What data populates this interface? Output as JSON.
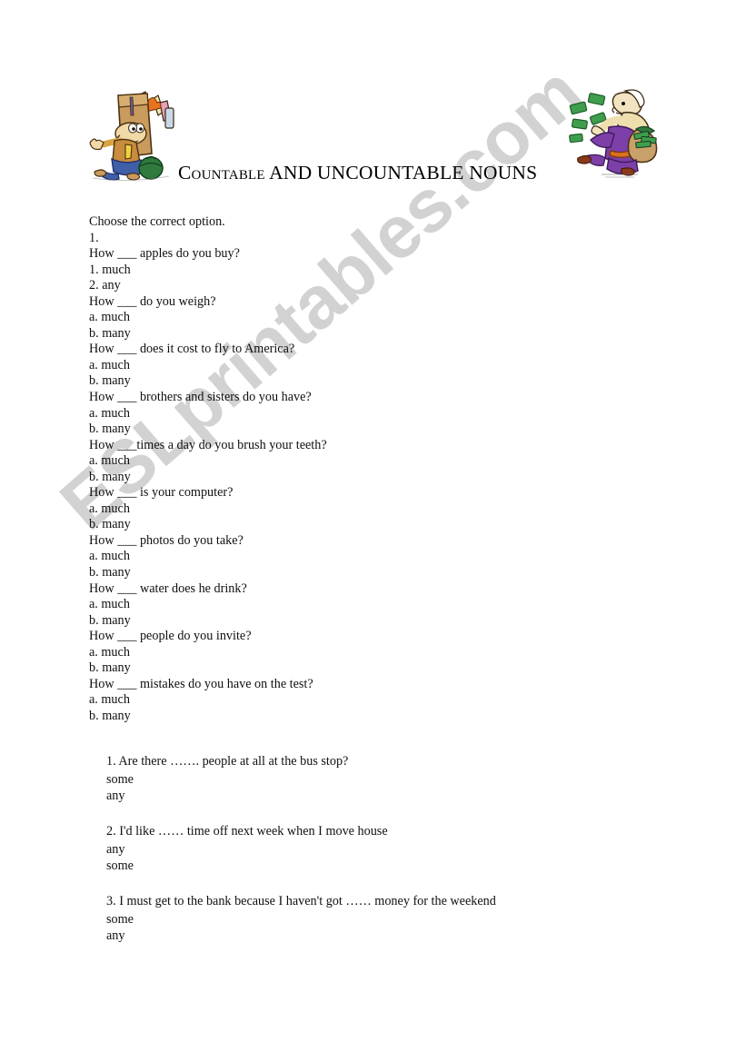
{
  "document": {
    "title": "COUNTABLE AND UNCOUNTABLE NOUNS",
    "title_first_word": "Countable",
    "title_rest": " AND UNCOUNTABLE NOUNS",
    "watermark": "ESLprintables.com",
    "watermark_color": "#d2d2d2",
    "page_background": "#ffffff",
    "text_color": "#101010"
  },
  "clipart": {
    "left": {
      "name": "man-carrying-grocery-bag",
      "description": "Cartoon man carrying a tall brown paper shopping bag overflowing with countable items"
    },
    "right": {
      "name": "man-throwing-money-from-sack",
      "description": "Cartoon man in purple robes tossing green banknotes out of a sack of money"
    }
  },
  "section_one": {
    "instruction": "Choose the correct option.",
    "number": "1.",
    "lines": [
      "How ___ apples do you buy?",
      "1. much",
      "2. any",
      "How ___ do you weigh?",
      "a. much",
      "b. many",
      "How ___ does it cost to fly to America?",
      "a. much",
      "b. many",
      "How ___ brothers and sisters do you have?",
      "a. much",
      "b. many",
      "How ___times a day do you brush your teeth?",
      "a. much",
      "b. many",
      "How ___ is your computer?",
      "a. much",
      "b. many",
      "How ___ photos do you take?",
      "a. much",
      "b. many",
      "How ___ water does he drink?",
      "a. much",
      "b. many",
      "How ___ people do you invite?",
      "a. much",
      "b. many",
      "How ___ mistakes do you have on the test?",
      "a. much",
      "b. many"
    ]
  },
  "section_two": {
    "items": [
      {
        "question": "1. Are there ……. people at all at the bus stop?",
        "options": [
          "some",
          "any"
        ]
      },
      {
        "question": "2. I'd like …… time off next week when I move house",
        "options": [
          "any",
          "some"
        ]
      },
      {
        "question": "3. I must get to the bank because I haven't got …… money for the weekend",
        "options": [
          "some",
          "any"
        ]
      }
    ]
  }
}
